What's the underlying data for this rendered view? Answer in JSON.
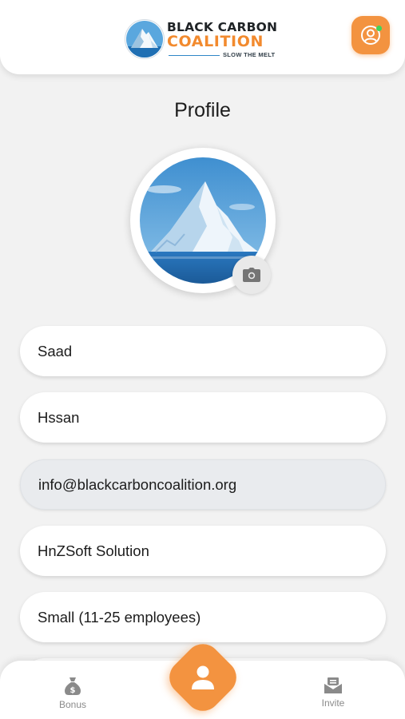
{
  "header": {
    "logo_line1": "BLACK CARBON",
    "logo_line2": "COALITION",
    "logo_tagline": "SLOW THE MELT",
    "profile_icon": "user-circle-icon",
    "status_color": "#3fd45a"
  },
  "page": {
    "title": "Profile"
  },
  "avatar": {
    "camera_icon": "camera-icon"
  },
  "form": {
    "first_name": "Saad",
    "last_name": "Hssan",
    "email": "info@blackcarboncoalition.org",
    "company": "HnZSoft Solution",
    "company_size": "Small (11-25 employees)",
    "extra": ""
  },
  "nav": {
    "bonus_label": "Bonus",
    "invite_label": "Invite",
    "center_icon": "user-icon",
    "accent_color": "#f39340"
  }
}
